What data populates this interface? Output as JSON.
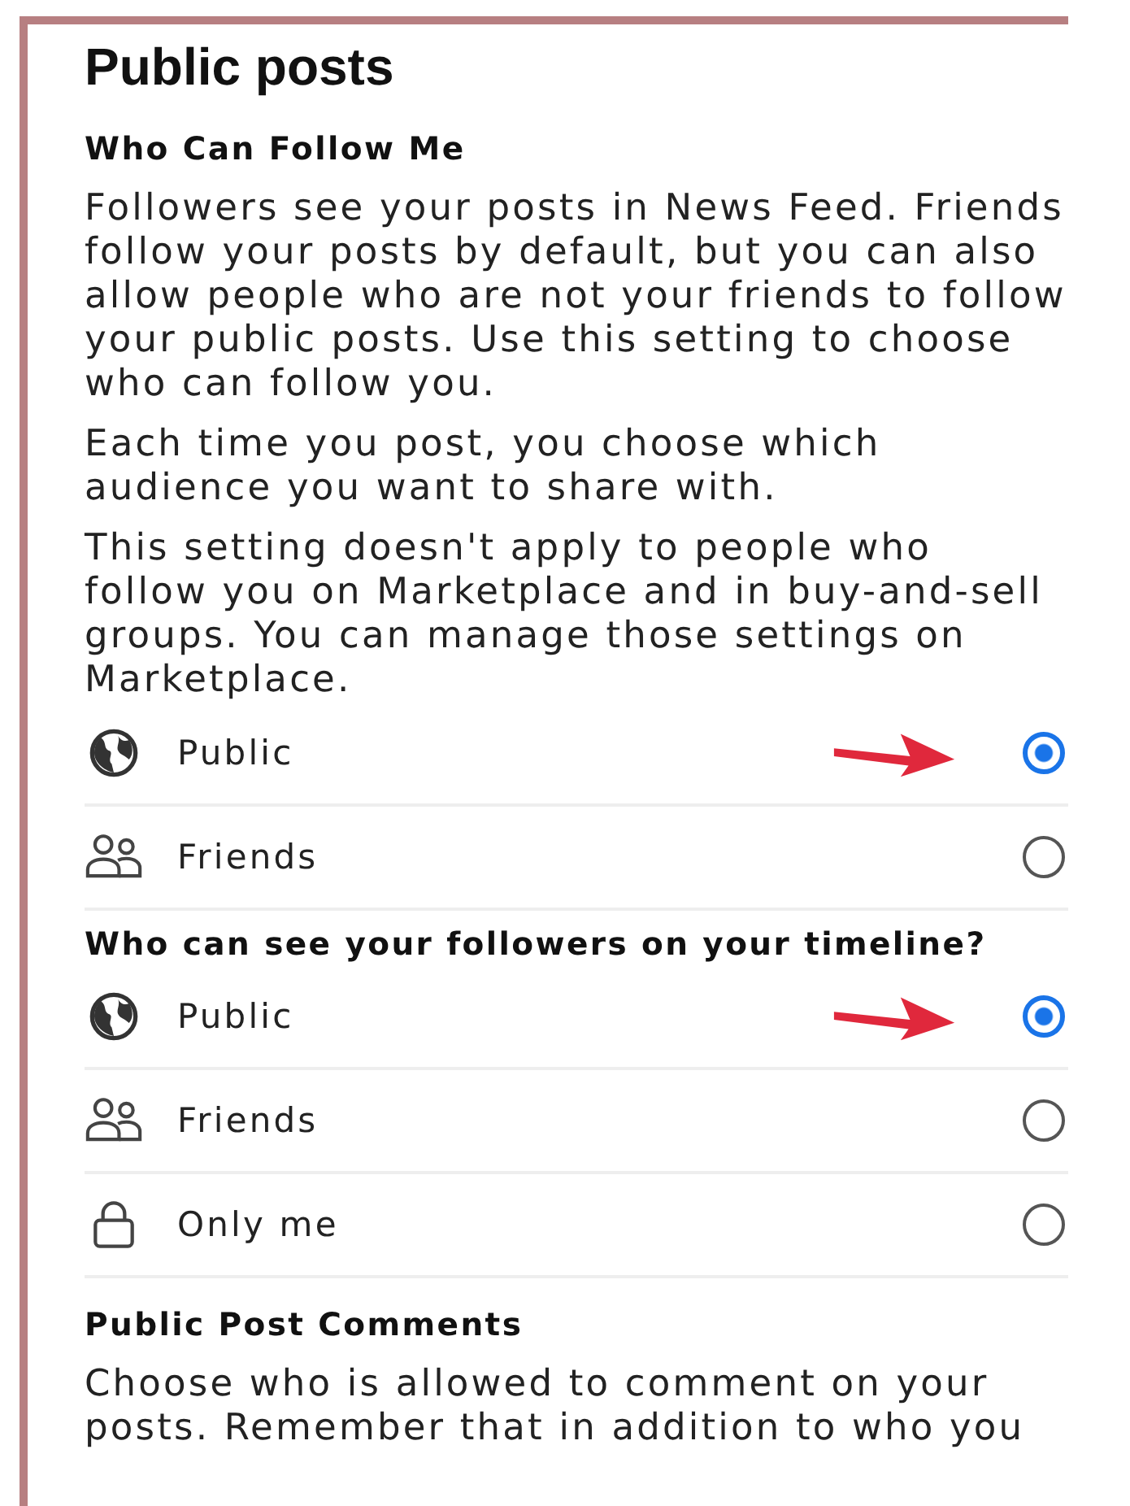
{
  "title": "Public posts",
  "sections": [
    {
      "heading": "Who Can Follow Me",
      "paragraphs": [
        "Followers see your posts in News Feed. Friends follow your posts by default, but you can also allow people who are not your friends to follow your public posts. Use this setting to choose who can follow you.",
        "Each time you post, you choose which audience you want to share with.",
        "This setting doesn't apply to people who follow you on Marketplace and in buy-and-sell groups. You can manage those settings on Marketplace."
      ],
      "options": [
        {
          "label": "Public",
          "kind": "globe",
          "selected": true,
          "arrow": true
        },
        {
          "label": "Friends",
          "kind": "people",
          "selected": false,
          "arrow": false
        }
      ]
    },
    {
      "heading": "Who can see your followers on your timeline?",
      "options": [
        {
          "label": "Public",
          "kind": "globe",
          "selected": true,
          "arrow": true
        },
        {
          "label": "Friends",
          "kind": "people",
          "selected": false,
          "arrow": false
        },
        {
          "label": "Only me",
          "kind": "lock",
          "selected": false,
          "arrow": false
        }
      ]
    },
    {
      "heading": "Public Post Comments",
      "paragraphs": [
        "Choose who is allowed to comment on your posts. Remember that in addition to who you"
      ]
    }
  ]
}
